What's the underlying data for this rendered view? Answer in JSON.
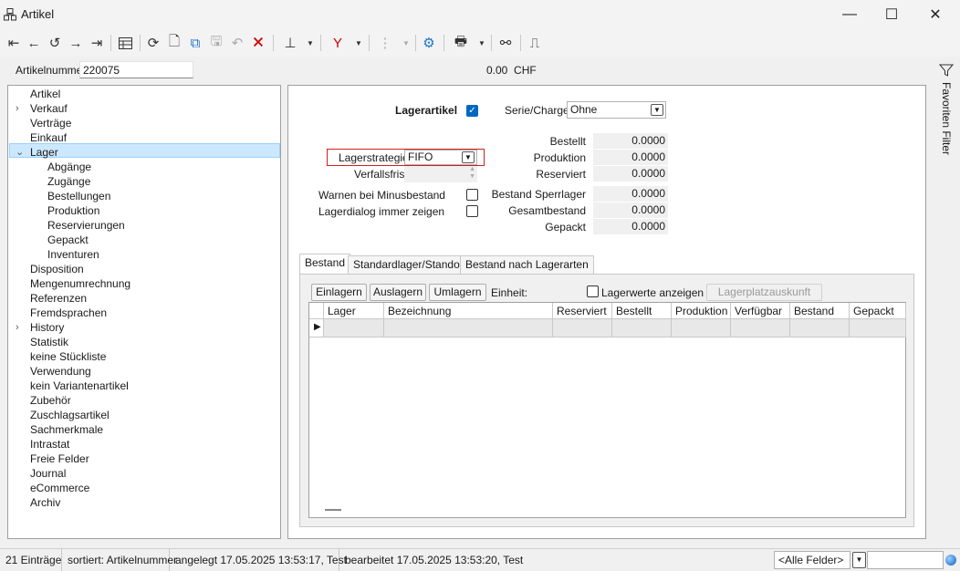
{
  "window": {
    "title": "Artikel"
  },
  "toolbar": {
    "icons": [
      "first-icon",
      "prev-icon",
      "history-icon",
      "next-icon",
      "last-icon",
      "table-icon",
      "refresh-icon",
      "new-doc-icon",
      "copy-icon",
      "save-icon",
      "undo-icon",
      "delete-icon",
      "pin-icon",
      "filter-icon",
      "tree-icon",
      "settings-icon",
      "print-icon",
      "link-icon",
      "door-icon"
    ]
  },
  "header": {
    "artikelnummer_label": "Artikelnummer",
    "artikelnummer_value": "220075",
    "price": "0.00",
    "currency": "CHF"
  },
  "tree": {
    "items": [
      {
        "label": "Artikel",
        "level": 0,
        "expander": ""
      },
      {
        "label": "Verkauf",
        "level": 0,
        "expander": "›"
      },
      {
        "label": "Verträge",
        "level": 0,
        "expander": ""
      },
      {
        "label": "Einkauf",
        "level": 0,
        "expander": ""
      },
      {
        "label": "Lager",
        "level": 0,
        "expander": "⌄"
      },
      {
        "label": "Abgänge",
        "level": 1,
        "expander": ""
      },
      {
        "label": "Zugänge",
        "level": 1,
        "expander": ""
      },
      {
        "label": "Bestellungen",
        "level": 1,
        "expander": ""
      },
      {
        "label": "Produktion",
        "level": 1,
        "expander": ""
      },
      {
        "label": "Reservierungen",
        "level": 1,
        "expander": ""
      },
      {
        "label": "Gepackt",
        "level": 1,
        "expander": ""
      },
      {
        "label": "Inventuren",
        "level": 1,
        "expander": ""
      },
      {
        "label": "Disposition",
        "level": 0,
        "expander": ""
      },
      {
        "label": "Mengenumrechnung",
        "level": 0,
        "expander": ""
      },
      {
        "label": "Referenzen",
        "level": 0,
        "expander": ""
      },
      {
        "label": "Fremdsprachen",
        "level": 0,
        "expander": ""
      },
      {
        "label": "History",
        "level": 0,
        "expander": "›"
      },
      {
        "label": "Statistik",
        "level": 0,
        "expander": ""
      },
      {
        "label": "keine Stückliste",
        "level": 0,
        "expander": ""
      },
      {
        "label": "Verwendung",
        "level": 0,
        "expander": ""
      },
      {
        "label": "kein Variantenartikel",
        "level": 0,
        "expander": ""
      },
      {
        "label": "Zubehör",
        "level": 0,
        "expander": ""
      },
      {
        "label": "Zuschlagsartikel",
        "level": 0,
        "expander": ""
      },
      {
        "label": "Sachmerkmale",
        "level": 0,
        "expander": ""
      },
      {
        "label": "Intrastat",
        "level": 0,
        "expander": ""
      },
      {
        "label": "Freie Felder",
        "level": 0,
        "expander": ""
      },
      {
        "label": "Journal",
        "level": 0,
        "expander": ""
      },
      {
        "label": "eCommerce",
        "level": 0,
        "expander": ""
      },
      {
        "label": "Archiv",
        "level": 0,
        "expander": ""
      }
    ]
  },
  "lager": {
    "lagerartikel_label": "Lagerartikel",
    "serie_label": "Serie/Charge",
    "serie_value": "Ohne",
    "lagerstrategie_label": "Lagerstrategie",
    "lagerstrategie_value": "FIFO",
    "verfallsfrist_label": "Verfallsfrist",
    "warnen_label": "Warnen bei Minusbestand",
    "lagerdialog_label": "Lagerdialog immer zeigen",
    "numbers": [
      {
        "label": "Bestellt",
        "value": "0.0000"
      },
      {
        "label": "Produktion",
        "value": "0.0000"
      },
      {
        "label": "Reserviert",
        "value": "0.0000"
      },
      {
        "label": "Bestand Sperrlager",
        "value": "0.0000"
      },
      {
        "label": "Gesamtbestand",
        "value": "0.0000"
      },
      {
        "label": "Gepackt",
        "value": "0.0000"
      }
    ]
  },
  "tabs": [
    "Bestand",
    "Standardlager/Standort",
    "Bestand nach Lagerarten"
  ],
  "bestand": {
    "einlagern": "Einlagern",
    "auslagern": "Auslagern",
    "umlagern": "Umlagern",
    "einheit": "Einheit:",
    "lagerwerte": "Lagerwerte anzeigen",
    "lagerplatz": "Lagerplatzauskunft",
    "columns": [
      "Lager",
      "Bezeichnung",
      "Reserviert",
      "Bestellt",
      "Produktion",
      "Verfügbar",
      "Bestand",
      "Gepackt"
    ]
  },
  "side": {
    "favoriten": "Favoriten Filter"
  },
  "status": {
    "count": "21 Einträge",
    "sort": "sortiert: Artikelnummer",
    "created": "angelegt 17.05.2025 13:53:17, Test",
    "edited": "bearbeitet 17.05.2025 13:53:20, Test",
    "fields": "<Alle Felder>"
  }
}
